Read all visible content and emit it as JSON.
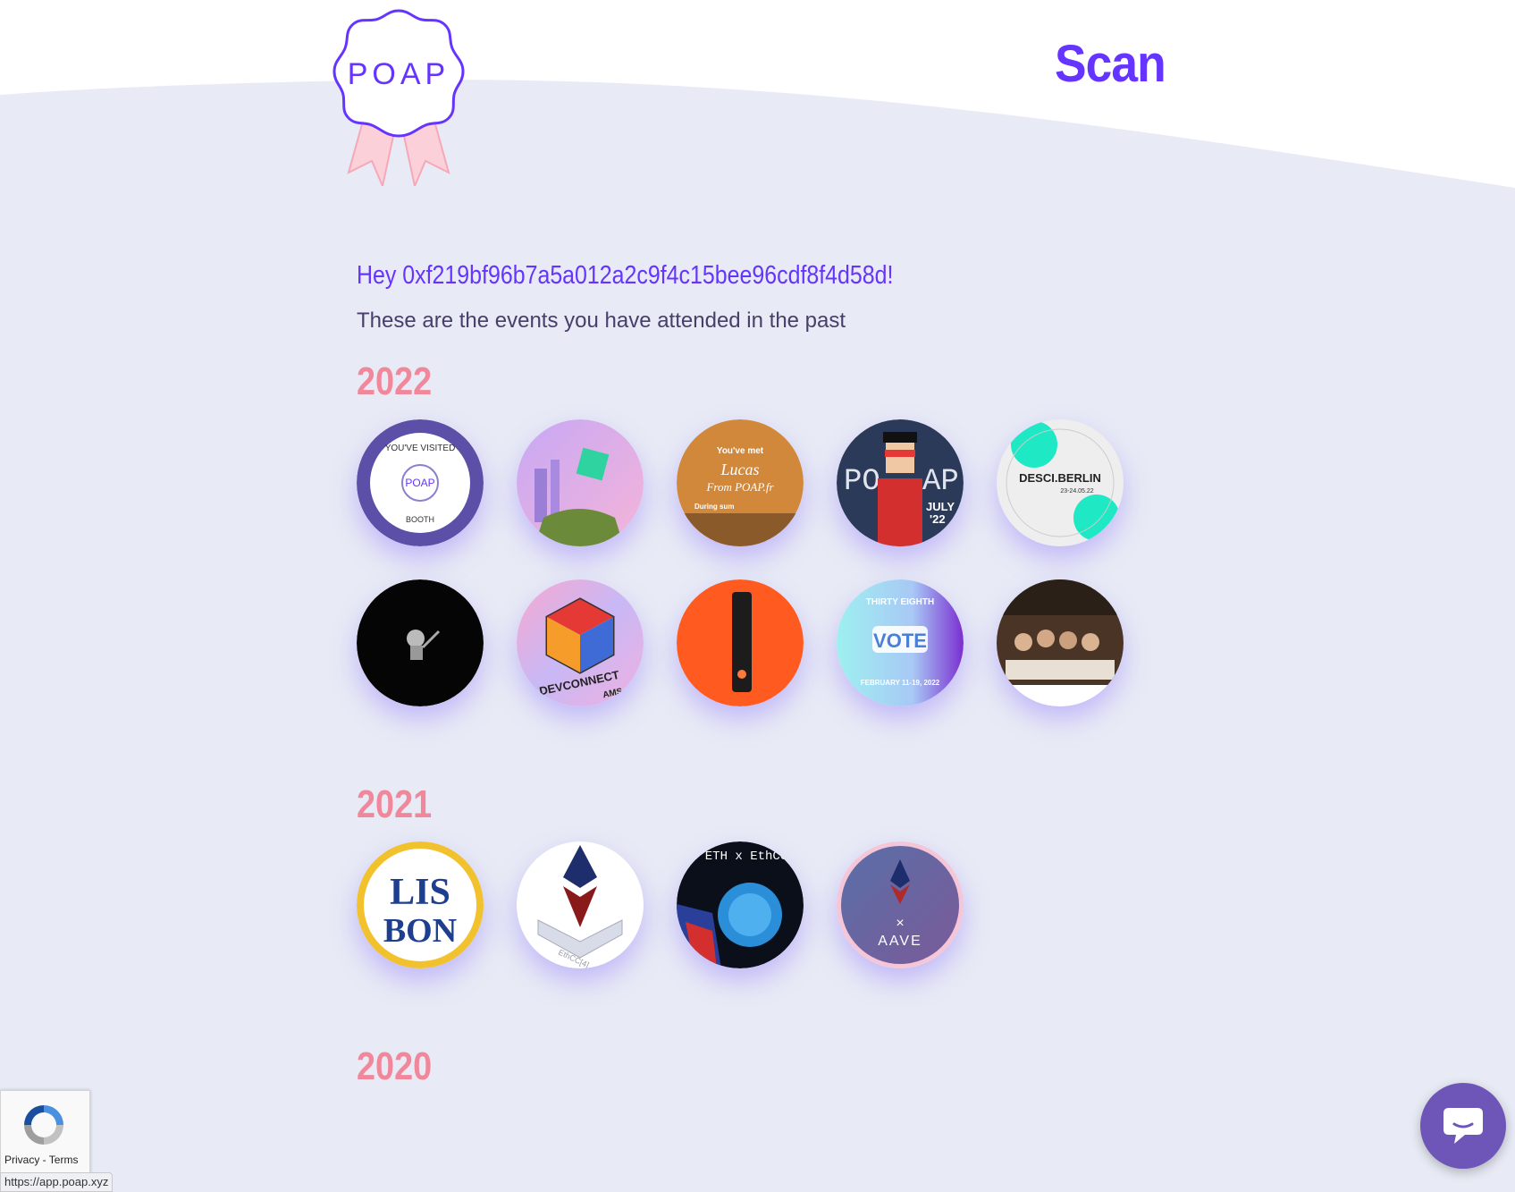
{
  "header": {
    "logo_text": "POAP",
    "scan_label": "Scan"
  },
  "main": {
    "greeting": "Hey 0xf219bf96b7a5a012a2c9f4c15bee96cdf8f4d58d!",
    "subtitle": "These are the events you have attended in the past",
    "years": [
      {
        "label": "2022",
        "badges": [
          "ethcc-booth-badge",
          "eth-barcelona-badge",
          "met-lucas-badge",
          "poap-pixel-july-badge",
          "desci-berlin-badge",
          "astronaut-badge",
          "devconnect-ams-badge",
          "ledger-device-badge",
          "thirty-eighth-vote-badge",
          "dinner-photo-badge"
        ]
      },
      {
        "label": "2021",
        "badges": [
          "lisbon-badge",
          "ethcc4-badge",
          "eth-x-ethcc-badge",
          "aave-ethcc-badge"
        ]
      },
      {
        "label": "2020",
        "badges": []
      }
    ],
    "badge_texts": {
      "ethcc_booth": {
        "top": "YOU'VE VISITED",
        "center": "POAP",
        "bottom": "BOOTH"
      },
      "met_lucas": {
        "line1": "You've met",
        "line2": "Lucas",
        "line3": "From POAP.fr",
        "line4": "During sum"
      },
      "poap_pixel": {
        "left": "PO",
        "right": "AP",
        "date1": "JULY",
        "date2": "'22"
      },
      "desci": {
        "title": "DESCI.BERLIN",
        "dates": "23-24.05.22"
      },
      "devconnect": {
        "title": "DEVCONNECT",
        "sub": "AMS"
      },
      "vote": {
        "top": "THIRTY EIGHTH",
        "center": "VOTE",
        "bottom": "FEBRUARY 11-19, 2022"
      },
      "lisbon": {
        "line1": "LIS",
        "line2": "BON"
      },
      "ethcc4": {
        "label": "EthCC[4]"
      },
      "eth_x": {
        "label": "ETH x EthCC"
      },
      "aave": {
        "label": "AAVE"
      }
    }
  },
  "recaptcha": {
    "privacy": "Privacy",
    "separator": " - ",
    "terms": "Terms"
  },
  "status_bar": {
    "url": "https://app.poap.xyz"
  },
  "colors": {
    "brand": "#6534ff",
    "year": "#f0879b",
    "background": "#e8ebf5",
    "chat": "#6e56b8"
  }
}
